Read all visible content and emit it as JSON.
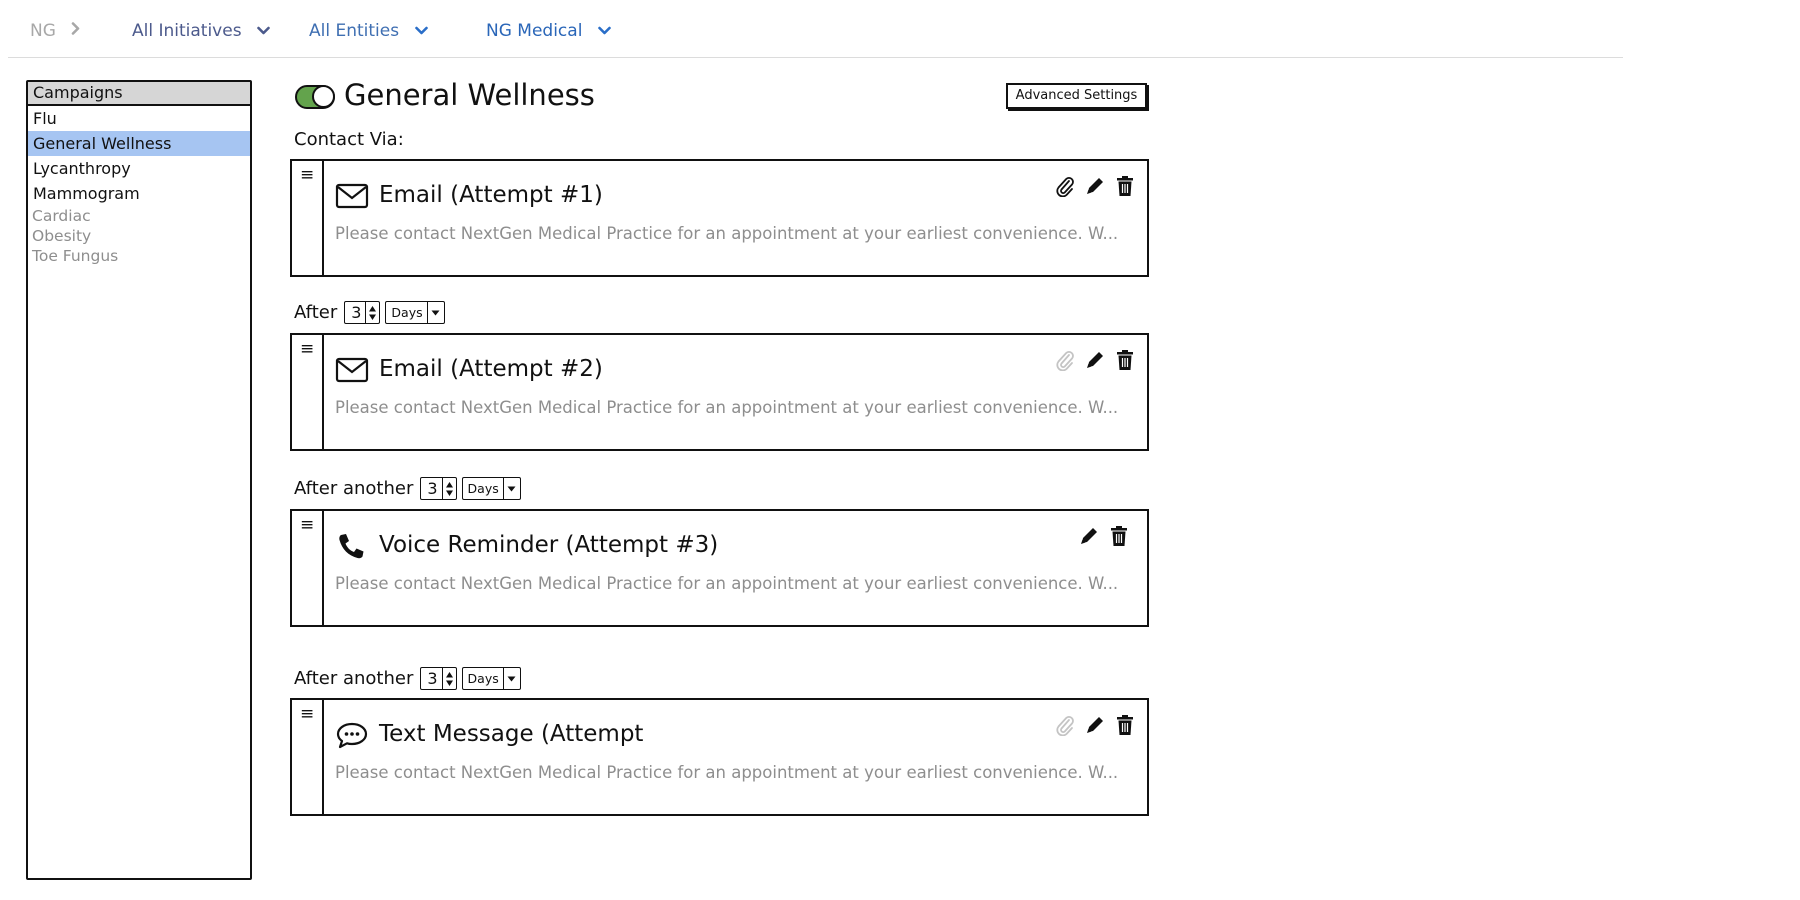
{
  "breadcrumb": {
    "root": "NG",
    "initiatives": "All Initiatives",
    "entities": "All Entities",
    "organization": "NG Medical"
  },
  "sidebar": {
    "header": "Campaigns",
    "items": [
      {
        "label": "Flu",
        "selected": false
      },
      {
        "label": "General Wellness",
        "selected": true
      },
      {
        "label": "Lycanthropy",
        "selected": false
      },
      {
        "label": "Mammogram",
        "selected": false
      }
    ],
    "inactive_items": [
      "Cardiac",
      "Obesity",
      "Toe Fungus"
    ]
  },
  "campaign": {
    "enabled": true,
    "title": "General Wellness",
    "advanced_settings_label": "Advanced Settings",
    "contact_via_label": "Contact Via:"
  },
  "steps": [
    {
      "icon": "envelope-icon",
      "title": "Email (Attempt #1)",
      "preview": "Please contact NextGen Medical Practice for an appointment at your earliest convenience. W...",
      "attachment": "active"
    },
    {
      "icon": "envelope-icon",
      "title": "Email (Attempt #2)",
      "preview": "Please contact NextGen Medical Practice for an appointment at your earliest convenience. W...",
      "attachment": "disabled"
    },
    {
      "icon": "phone-icon",
      "title": "Voice Reminder (Attempt #3)",
      "preview": "Please contact NextGen Medical Practice for an appointment at your earliest convenience. W...",
      "attachment": "none"
    },
    {
      "icon": "speech-bubble-icon",
      "title": "Text Message (Attempt",
      "preview": "Please contact NextGen Medical Practice for an appointment at your earliest convenience. W...",
      "attachment": "disabled"
    }
  ],
  "delays": [
    {
      "label": "After",
      "value": "3",
      "unit": "Days"
    },
    {
      "label": "After another",
      "value": "3",
      "unit": "Days"
    },
    {
      "label": "After another",
      "value": "3",
      "unit": "Days"
    }
  ],
  "colors": {
    "toggle_on": "#63a34c",
    "selected_row": "#a6c5f2",
    "link_blue": "#2a66b8",
    "muted_text": "#8e8e8e"
  }
}
